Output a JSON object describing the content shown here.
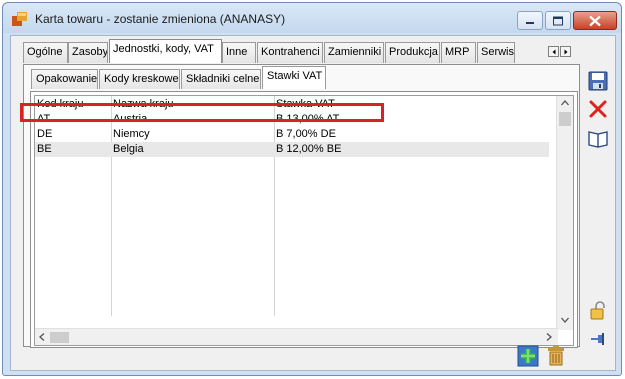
{
  "window": {
    "title": "Karta towaru - zostanie zmieniona (ANANASY)"
  },
  "tabs": [
    {
      "label": "Ogólne"
    },
    {
      "label": "Zasoby"
    },
    {
      "label": "Jednostki, kody, VAT",
      "active": true
    },
    {
      "label": "Inne"
    },
    {
      "label": "Kontrahenci"
    },
    {
      "label": "Zamienniki"
    },
    {
      "label": "Produkcja"
    },
    {
      "label": "MRP"
    },
    {
      "label": "Serwis"
    }
  ],
  "subtabs": [
    {
      "label": "Opakowanie"
    },
    {
      "label": "Kody kreskowe"
    },
    {
      "label": "Składniki celne"
    },
    {
      "label": "Stawki VAT",
      "active": true
    }
  ],
  "grid": {
    "columns": [
      "Kod kraju",
      "Nazwa kraju",
      "Stawka VAT"
    ],
    "rows": [
      {
        "code": "AT",
        "country": "Austria",
        "vat": "B 13,00% AT"
      },
      {
        "code": "DE",
        "country": "Niemcy",
        "vat": "B 7,00% DE"
      },
      {
        "code": "BE",
        "country": "Belgia",
        "vat": "B 12,00% BE"
      }
    ],
    "highlighted_row": 0
  },
  "colors": {
    "highlight": "#d8222a",
    "titlebar": "#c4d8ee"
  },
  "icons": {
    "save": "save-icon",
    "delete": "delete-icon",
    "book": "book-icon",
    "lock": "lock-icon",
    "pin": "pin-icon",
    "add": "add-icon",
    "trash": "trash-icon"
  }
}
